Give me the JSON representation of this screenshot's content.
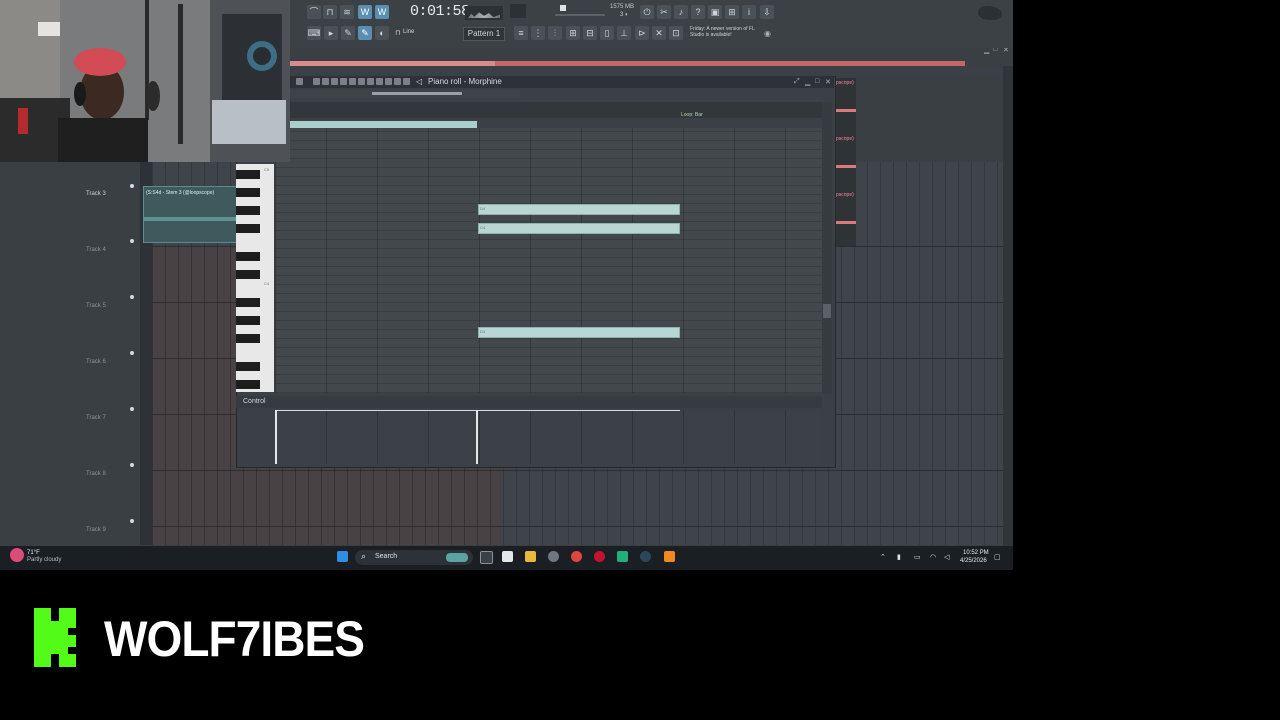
{
  "toolbar": {
    "time": "0:01:58",
    "time_small": "M:S:CS",
    "memory": "1575 MB",
    "cpu": "3 ◐",
    "pattern": "Pattern 1",
    "snap": "Line",
    "news": "Friday: A newer version of FL Studio is available!"
  },
  "piano_roll": {
    "title": "Piano roll - Morphine",
    "loop_marker": "Loop: Bar",
    "control": "Control",
    "key_c5": "C5",
    "key_c4": "C4",
    "notes": [
      {
        "label": "D4"
      },
      {
        "label": "C4"
      },
      {
        "label": "D3"
      }
    ]
  },
  "playlist": {
    "tracks": [
      "Track 3",
      "Track 4",
      "Track 5",
      "Track 6",
      "Track 7",
      "Track 8",
      "Track 9"
    ],
    "clip_label": "(S:S4d - Stem 3 (@loopscope)",
    "right_clips": [
      "pscope)",
      "pscope)",
      "pscope)"
    ]
  },
  "taskbar": {
    "weather_temp": "71°F",
    "weather_desc": "Partly cloudy",
    "search": "Search",
    "clock_time": "10:52 PM",
    "clock_date": "4/25/2026"
  },
  "brand": {
    "name": "WOLF7IBES",
    "accent": "#53fc18"
  }
}
